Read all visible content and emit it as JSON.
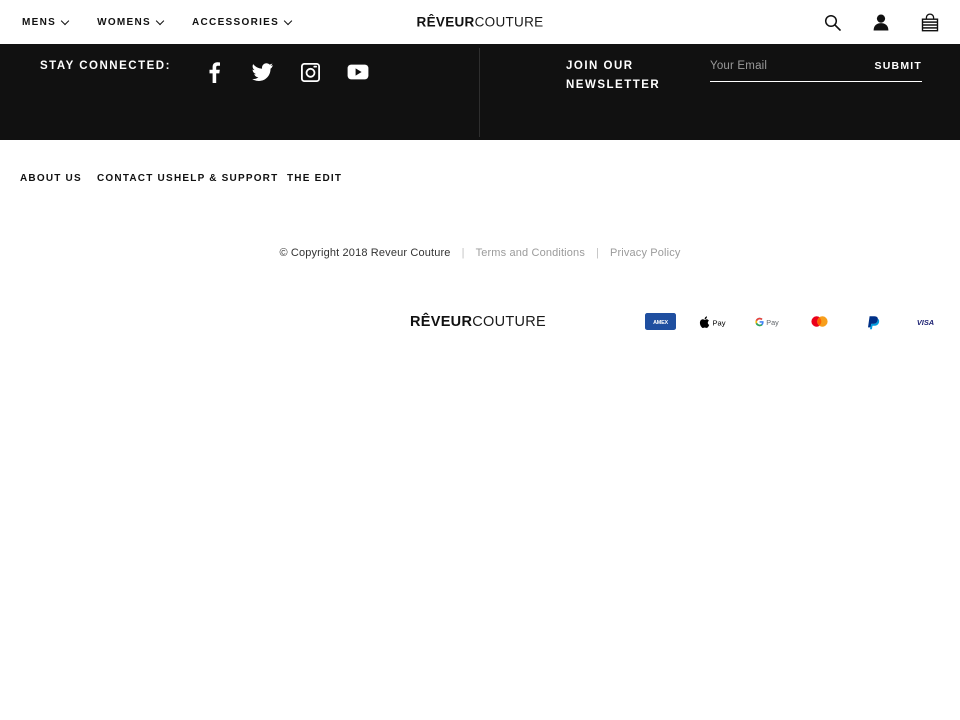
{
  "header": {
    "nav": [
      {
        "label": "MENS",
        "has_dropdown": true
      },
      {
        "label": "WOMENS",
        "has_dropdown": true
      },
      {
        "label": "ACCESSORIES",
        "has_dropdown": true
      }
    ],
    "logo": {
      "bold": "RÊVEUR",
      "light": "COUTURE"
    },
    "icons": [
      {
        "name": "search-icon",
        "label": "Search"
      },
      {
        "name": "account-icon",
        "label": "Account"
      },
      {
        "name": "basket-icon",
        "label": "Basket"
      }
    ]
  },
  "connect": {
    "title": "STAY CONNECTED:",
    "socials": [
      {
        "name": "facebook-icon",
        "label": "Facebook"
      },
      {
        "name": "twitter-icon",
        "label": "Twitter"
      },
      {
        "name": "instagram-icon",
        "label": "Instagram"
      },
      {
        "name": "youtube-icon",
        "label": "YouTube"
      }
    ]
  },
  "newsletter": {
    "title": "JOIN OUR NEWSLETTER",
    "placeholder": "Your Email",
    "value": "",
    "submit_label": "SUBMIT"
  },
  "footer": {
    "links": [
      {
        "label": "ABOUT US"
      },
      {
        "label": "CONTACT US"
      },
      {
        "label": "HELP & SUPPORT"
      },
      {
        "label": "THE EDIT"
      }
    ],
    "logo": {
      "bold": "RÊVEUR",
      "light": "COUTURE"
    },
    "payments": [
      {
        "name": "amex-badge",
        "label": "AMEX",
        "color": "#1F4FA0"
      },
      {
        "name": "apple-pay-badge",
        "label": "Apple Pay",
        "color": "#000000"
      },
      {
        "name": "google-pay-badge",
        "label": "G Pay",
        "color": "#5F6368"
      },
      {
        "name": "mastercard-badge",
        "label": "Mastercard",
        "color": "#EB001B"
      },
      {
        "name": "paypal-badge",
        "label": "PayPal",
        "color": "#003087"
      },
      {
        "name": "visa-badge",
        "label": "VISA",
        "color": "#1A1F71"
      }
    ]
  },
  "copyright": {
    "text": "© Copyright 2018 Reveur Couture",
    "separator": "|",
    "terms_label": "Terms and Conditions",
    "privacy_label": "Privacy Policy"
  },
  "colors": {
    "dark_band": "#111111",
    "page_bg": "#ffffff",
    "text": "#111111",
    "muted_link": "#9b9b9b"
  }
}
